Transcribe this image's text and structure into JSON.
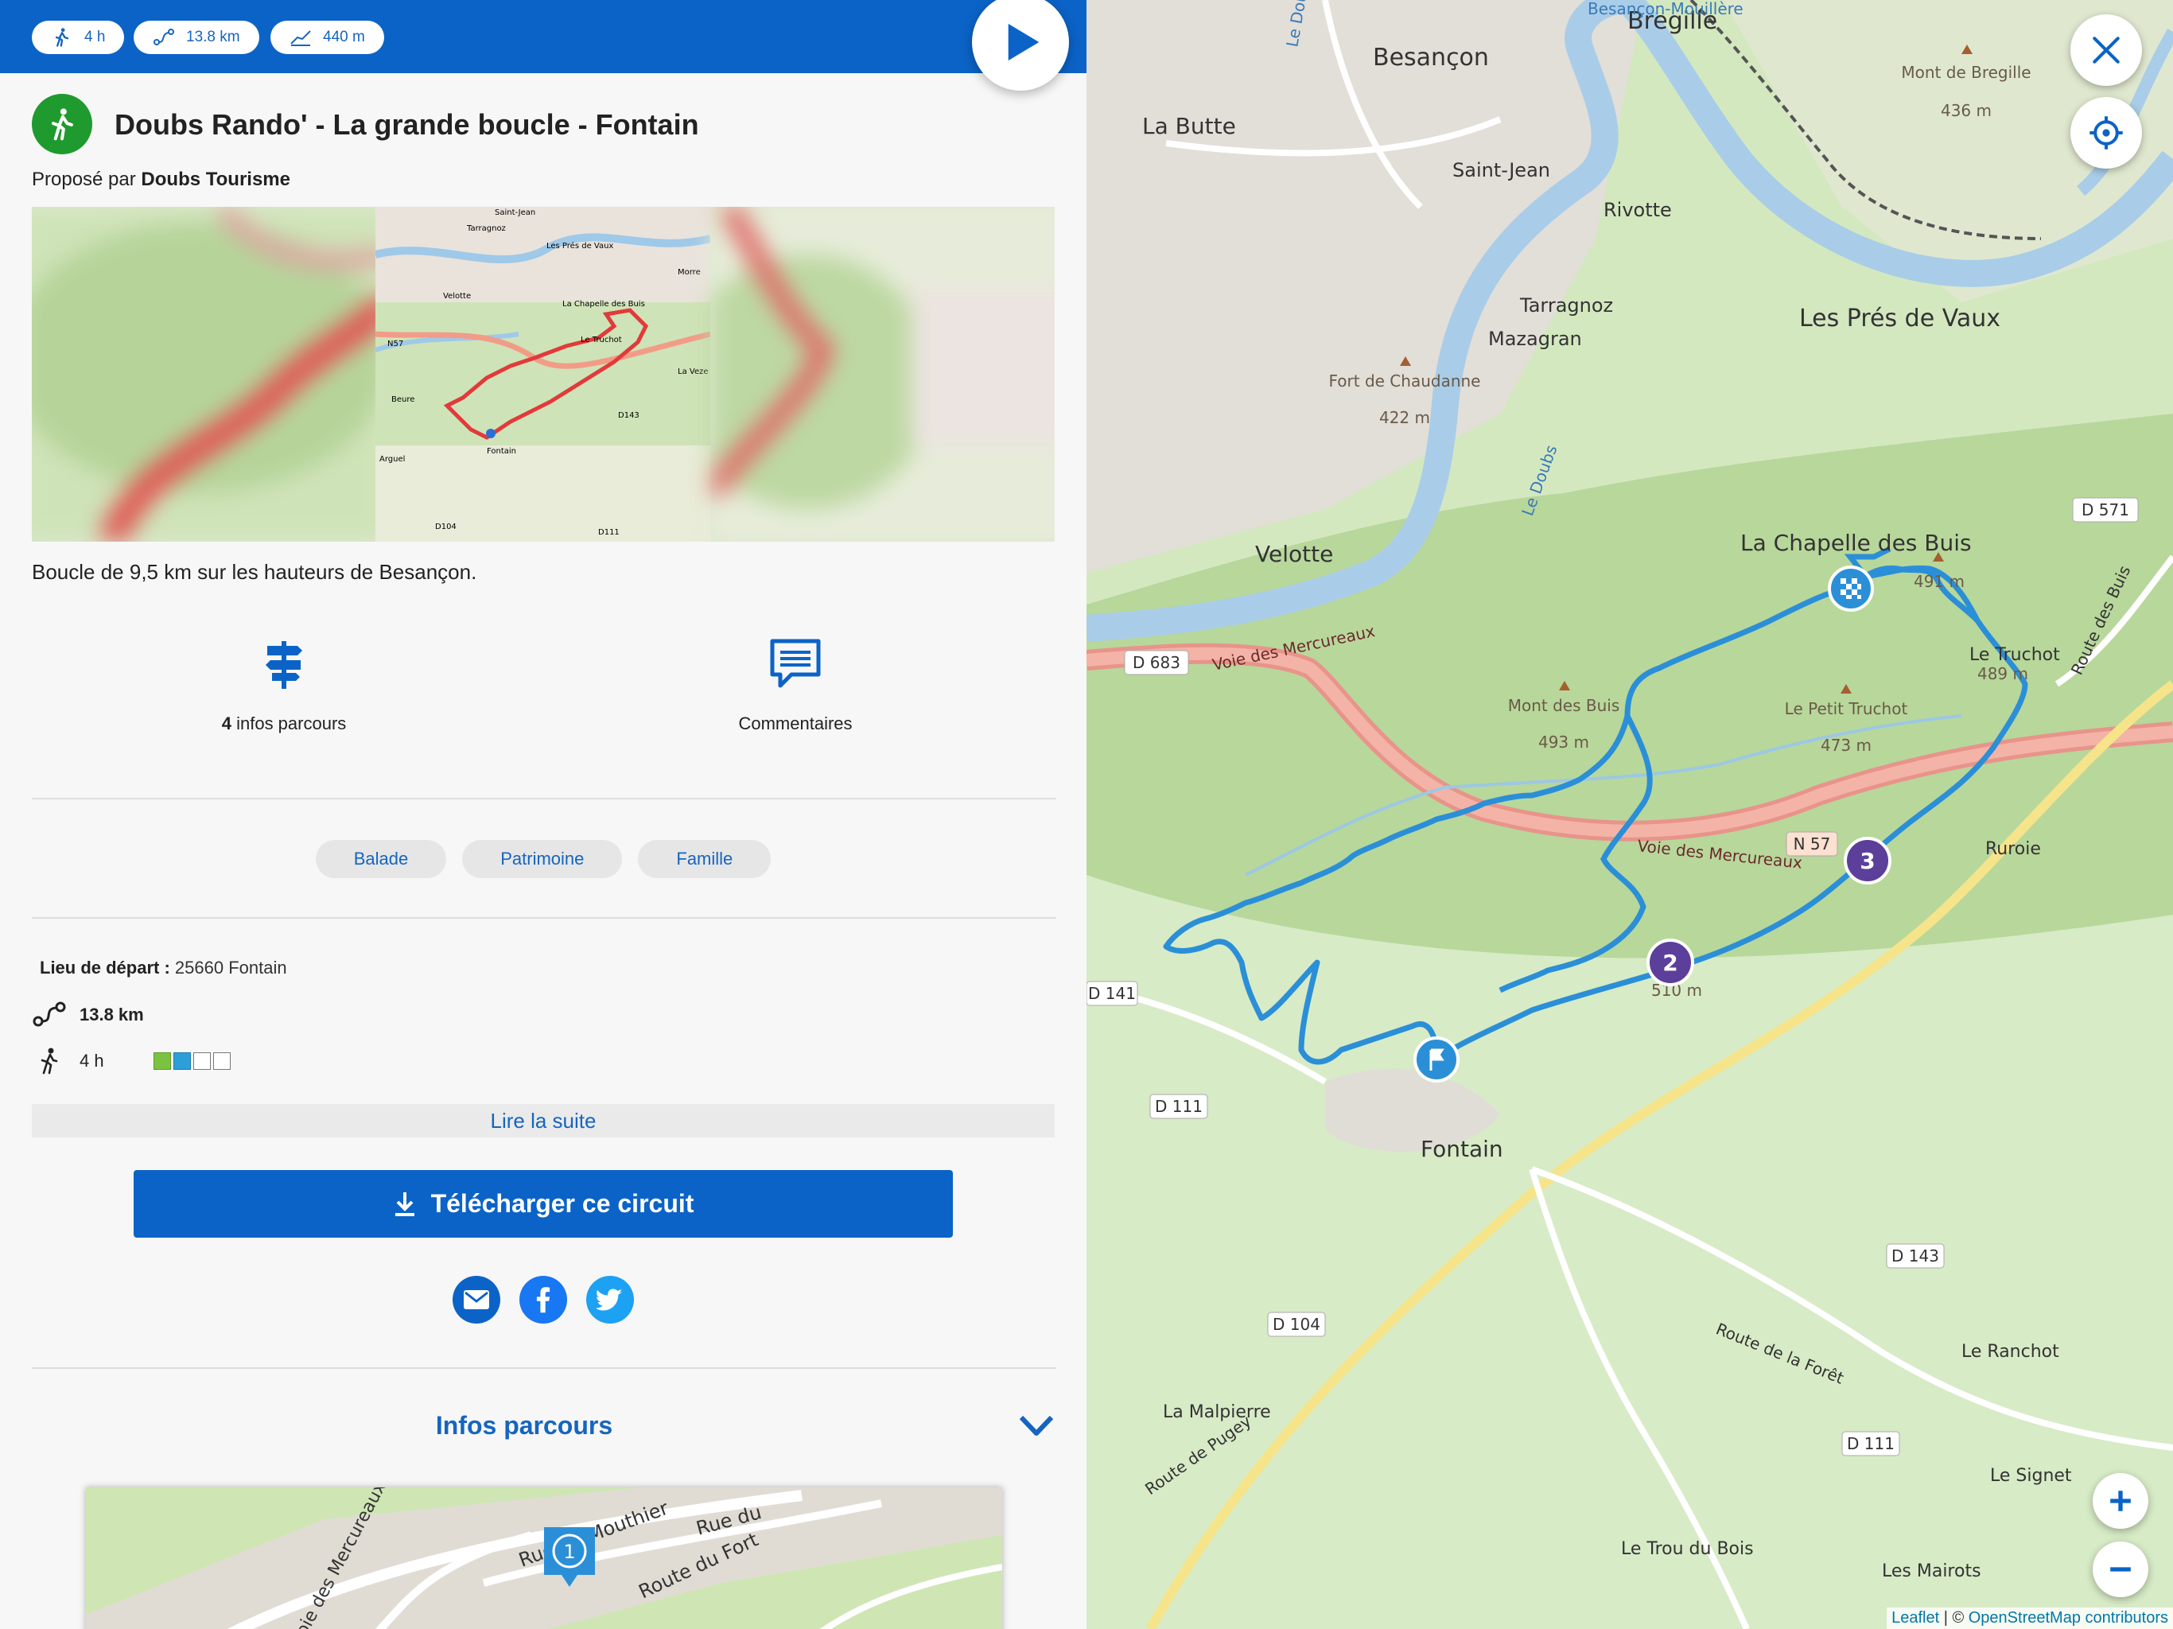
{
  "header": {
    "stats": [
      {
        "icon": "hiker-icon",
        "value": "4 h"
      },
      {
        "icon": "route-distance-icon",
        "value": "13.8 km"
      },
      {
        "icon": "elevation-icon",
        "value": "440 m"
      }
    ]
  },
  "trail": {
    "title": "Doubs Rando' - La grande boucle - Fontain",
    "proposed_by_prefix": "Proposé par",
    "author": "Doubs Tourisme",
    "description": "Boucle de 9,5 km sur les hauteurs de Besançon."
  },
  "gallery_map_labels": [
    "Saint-Jean",
    "Tarragnoz",
    "Les Prés de Vaux",
    "Velotte",
    "La Chapelle des Buis",
    "Le Truchot",
    "N57",
    "Beure",
    "Fontain",
    "Arguel",
    "D143",
    "D104",
    "D111",
    "Morre",
    "La Veze"
  ],
  "features": {
    "infos_count": "4",
    "infos_label": "infos parcours",
    "comments_label": "Commentaires"
  },
  "tags": [
    "Balade",
    "Patrimoine",
    "Famille"
  ],
  "details": {
    "start_label": "Lieu de départ :",
    "start_value": "25660 Fontain",
    "distance": "13.8 km",
    "duration": "4 h",
    "difficulty_level": 2,
    "difficulty_max": 4,
    "difficulty_colors": [
      "#7cc242",
      "#2d9fd8"
    ]
  },
  "actions": {
    "read_more": "Lire la suite",
    "download": "Télécharger ce circuit"
  },
  "share": [
    "mail-icon",
    "facebook-icon",
    "twitter-icon"
  ],
  "infos_section": {
    "title": "Infos parcours",
    "mini_map_labels": [
      "Rue du Mouthier",
      "Route du Fort",
      "Voie des Mercureaux",
      "Rue du"
    ],
    "marker": "1"
  },
  "map": {
    "places": [
      {
        "name": "Besançon"
      },
      {
        "name": "Bregille"
      },
      {
        "name": "Besançon-Mouillère"
      },
      {
        "name": "La Butte"
      },
      {
        "name": "Saint-Jean"
      },
      {
        "name": "Rivotte"
      },
      {
        "name": "Tarragnoz"
      },
      {
        "name": "Mazagran"
      },
      {
        "name": "Les Prés de Vaux"
      },
      {
        "name": "Velotte"
      },
      {
        "name": "La Chapelle des Buis"
      },
      {
        "name": "Le Truchot"
      },
      {
        "name": "Ruroie"
      },
      {
        "name": "Fontain"
      },
      {
        "name": "Le Ranchot"
      },
      {
        "name": "La Malpierre"
      },
      {
        "name": "Le Signet"
      },
      {
        "name": "Le Trou du Bois"
      },
      {
        "name": "Les Mairots"
      }
    ],
    "peaks": [
      {
        "name": "Mont de Bregille",
        "elevation": "436 m"
      },
      {
        "name": "Fort de Chaudanne",
        "elevation": "422 m"
      },
      {
        "name": "Mont des Buis",
        "elevation": "493 m"
      },
      {
        "name": "Le Petit Truchot",
        "elevation": "473 m"
      },
      {
        "name": "Le Truchot",
        "elevation": "489 m"
      },
      {
        "name": "",
        "elevation": "491 m"
      },
      {
        "name": "",
        "elevation": "510 m"
      }
    ],
    "roads": [
      "D 683",
      "Voie des Mercureaux",
      "N 57",
      "D 571",
      "D 141",
      "D 111",
      "D 104",
      "D 143",
      "D 111",
      "Route de la Forêt",
      "Route de Pugey",
      "Route des Buis"
    ],
    "rivers": [
      "Le Doubs"
    ],
    "waypoints": [
      "2",
      "3"
    ],
    "attribution_leaflet": "Leaflet",
    "attribution_sep": " | © ",
    "attribution_osm": "OpenStreetMap contributors",
    "route_color": "#2b8fd8",
    "accent_color": "#0b63c7"
  }
}
